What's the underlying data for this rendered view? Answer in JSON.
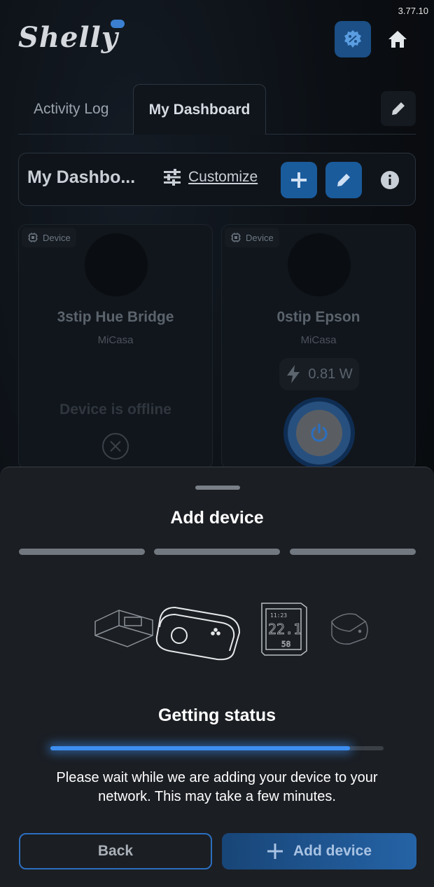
{
  "app": {
    "version": "3.77.10",
    "logo_text": "Shelly",
    "colors": {
      "accent": "#2b6fc0",
      "progress": "#3d8ef0"
    }
  },
  "header": {
    "badge_icon": "percent-badge-icon",
    "home_icon": "home-icon"
  },
  "tabs": [
    {
      "label": "Activity Log"
    },
    {
      "label": "My Dashboard",
      "active": true
    }
  ],
  "dashboard": {
    "title": "My Dashbo...",
    "customize_label": "Customize"
  },
  "cards": [
    {
      "tag": "Device",
      "name": "3stip Hue Bridge",
      "room": "MiCasa",
      "status": "Device is offline"
    },
    {
      "tag": "Device",
      "name": "0stip Epson",
      "room": "MiCasa",
      "power": "0.81 W"
    }
  ],
  "sheet": {
    "title": "Add device",
    "steps_total": 3,
    "device_display_lines": [
      "11:23",
      "22.1",
      "58"
    ],
    "status_title": "Getting status",
    "progress": 0.9,
    "message": "Please wait while we are adding your device to your network. This may take a few minutes.",
    "back_label": "Back",
    "add_label": "Add device"
  }
}
